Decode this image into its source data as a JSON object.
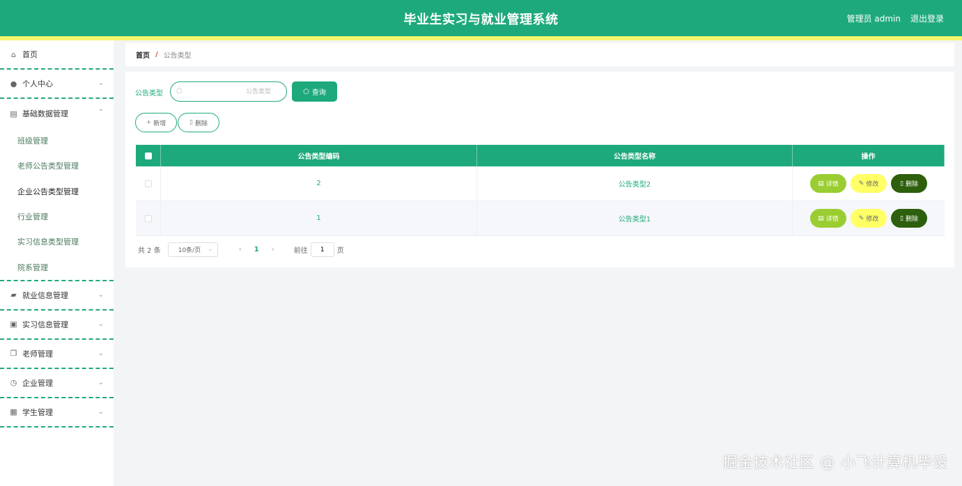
{
  "header": {
    "title": "毕业生实习与就业管理系统",
    "user": "管理员 admin",
    "logout": "退出登录"
  },
  "sidebar": {
    "items": [
      {
        "label": "首页",
        "icon": "home-icon"
      },
      {
        "label": "个人中心",
        "icon": "user-icon"
      },
      {
        "label": "基础数据管理",
        "icon": "data-icon"
      }
    ],
    "submenu": [
      "班级管理",
      "老师公告类型管理",
      "企业公告类型管理",
      "行业管理",
      "实习信息类型管理",
      "院系管理"
    ],
    "bottom_items": [
      {
        "label": "就业信息管理",
        "icon": "employment-icon"
      },
      {
        "label": "实习信息管理",
        "icon": "briefcase-icon"
      },
      {
        "label": "老师管理",
        "icon": "teacher-icon"
      },
      {
        "label": "企业管理",
        "icon": "clock-icon"
      },
      {
        "label": "学生管理",
        "icon": "grid-icon"
      }
    ]
  },
  "breadcrumb": {
    "home": "首页",
    "sep": "/",
    "current": "公告类型"
  },
  "search": {
    "label": "公告类型",
    "placeholder": "公告类型",
    "button": "查询"
  },
  "actions": {
    "add": "新增",
    "delete": "删除"
  },
  "table": {
    "columns": [
      "公告类型编码",
      "公告类型名称",
      "操作"
    ],
    "rows": [
      {
        "code": "2",
        "name": "公告类型2"
      },
      {
        "code": "1",
        "name": "公告类型1"
      }
    ],
    "ops": {
      "detail": "详情",
      "edit": "修改",
      "delete": "删除"
    }
  },
  "pagination": {
    "total": "共 2 条",
    "page_size": "10条/页",
    "current_page": "1",
    "goto_label": "前往",
    "goto_value": "1",
    "page_suffix": "页"
  },
  "watermark": "掘金技术社区 @ 小飞计算机毕设",
  "colors": {
    "primary": "#1ea97c",
    "stripe": "#f5f56b",
    "detail": "#9acd32",
    "edit": "#ffff66",
    "delete": "#2d5f0d"
  }
}
